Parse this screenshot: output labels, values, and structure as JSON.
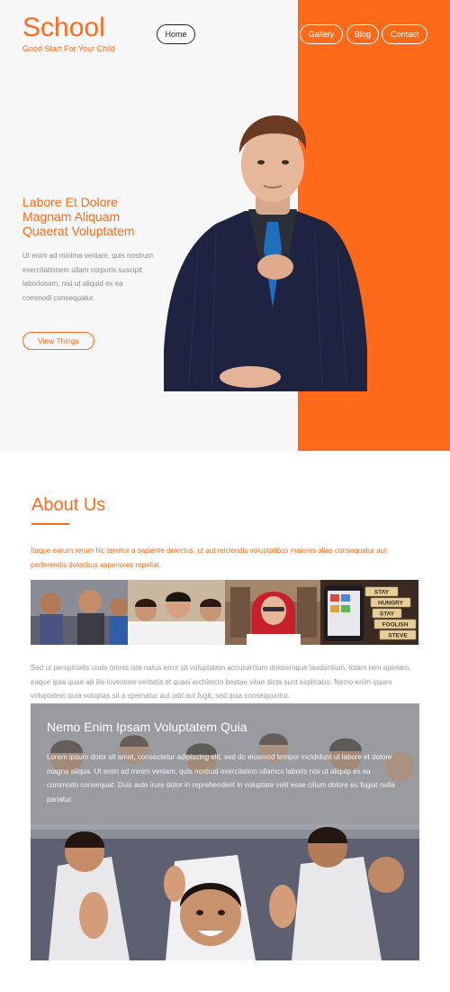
{
  "brand": {
    "title": "School",
    "tagline": "Good Start For Your Child"
  },
  "nav": {
    "home": "Home",
    "gallery": "Gallery",
    "blog": "Blog",
    "contact": "Contact"
  },
  "hero": {
    "heading": "Labore Et Dolore Magnam Aliquam Quaerat Voluptatem",
    "text": "Ut enim ad minima veniam, quis nostrum exercitationem ullam corporis suscipit laboriosam, nisi ut aliquid ex ea commodi consequatur.",
    "button": "View Things"
  },
  "about": {
    "title": "About Us",
    "lead": "Itaque earum rerum hic tenetur a sapiente delectus, ut aut reiciendis voluptatibus maiores alias consequatur aut perferendis doloribus asperiores repellat.",
    "body": "Sed ut perspiciatis unde omnis iste natus error sit voluptatem accusantium doloremque laudantium, totam rem aperiam, eaque ipsa quae ab illo inventore veritatis et quasi architecto beatae vitae dicta sunt explicabo. Nemo enim ipsam voluptatem quia voluptas sit a spernatur aut odit aut fugit, sed quia consequuntur.",
    "scrabble_tiles": [
      "STAY",
      "HUNGRY",
      "STAY",
      "FOOLISH",
      "STEVE"
    ]
  },
  "feature": {
    "title": "Nemo Enim Ipsam Voluptatem Quia",
    "text": "Lorem ipsum dolor sit amet, consectetur adipiscing elit, sed do eiusmod tempor incididunt ut labore et dolore magna aliqua. Ut enim ad minim veniam, quis nostrud exercitation ullamco laboris nisi ut aliquip ex ea commodo consequat. Duis aute irure dolor in reprehenderit in voluptate velit esse cillum dolore eu fugiat nulla pariatur."
  },
  "colors": {
    "accent": "#ff6a1a",
    "hero_bg": "#f7f7f7"
  }
}
